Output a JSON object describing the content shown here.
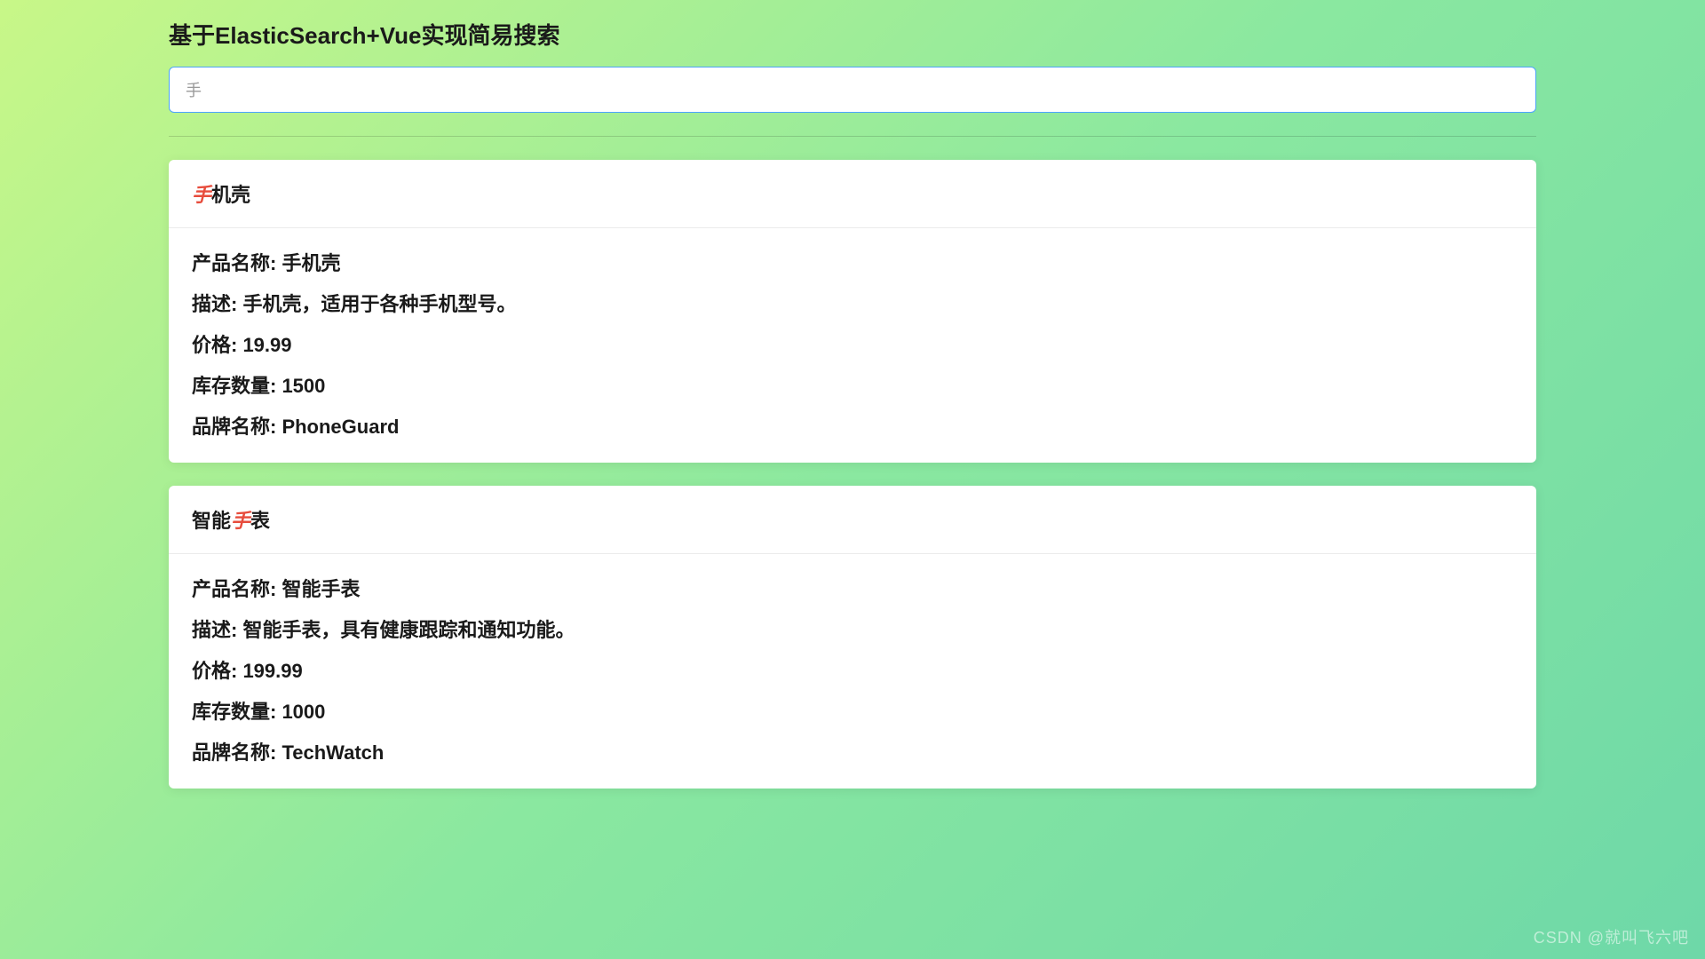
{
  "page": {
    "title": "基于ElasticSearch+Vue实现简易搜索"
  },
  "search": {
    "value": "手",
    "highlight": "手"
  },
  "labels": {
    "product_name": "产品名称",
    "description": "描述",
    "price": "价格",
    "stock": "库存数量",
    "brand": "品牌名称"
  },
  "results": [
    {
      "title_parts": [
        "",
        "手",
        "机壳"
      ],
      "name": "手机壳",
      "description": "手机壳，适用于各种手机型号。",
      "price": "19.99",
      "stock": "1500",
      "brand": "PhoneGuard"
    },
    {
      "title_parts": [
        "智能",
        "手",
        "表"
      ],
      "name": "智能手表",
      "description": "智能手表，具有健康跟踪和通知功能。",
      "price": "199.99",
      "stock": "1000",
      "brand": "TechWatch"
    }
  ],
  "watermark": "CSDN @就叫飞六吧"
}
